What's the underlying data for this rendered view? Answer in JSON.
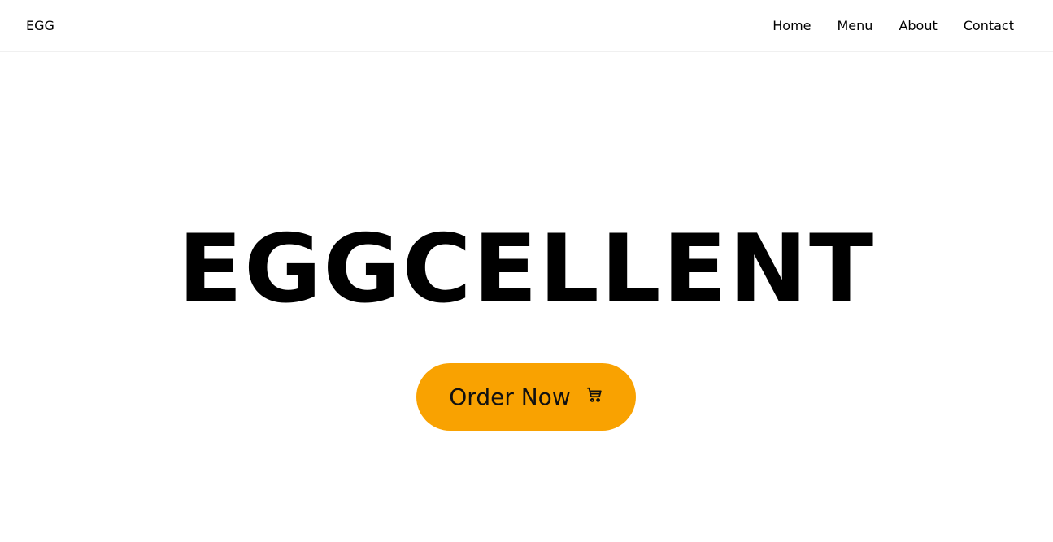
{
  "navbar": {
    "brand": "EGG",
    "links": [
      {
        "label": "Home"
      },
      {
        "label": "Menu"
      },
      {
        "label": "About"
      },
      {
        "label": "Contact"
      }
    ]
  },
  "hero": {
    "title": "EGGCELLENT",
    "cta": {
      "label": "Order Now",
      "icon": "shopping-cart-icon",
      "color": "#f9a201"
    }
  }
}
